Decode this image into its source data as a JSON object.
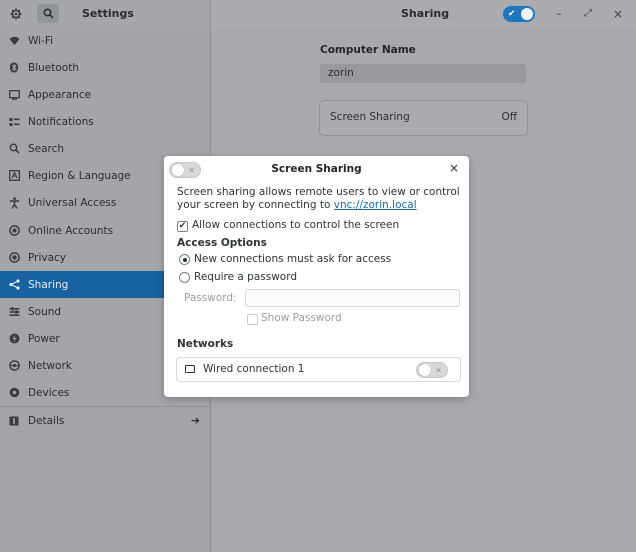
{
  "sidebar_header": {
    "title": "Settings",
    "gear_icon": "gear-icon",
    "search_icon": "search-icon"
  },
  "main_header": {
    "title": "Sharing",
    "toggle_on": true
  },
  "window_controls": {
    "minimize": "–",
    "maximize": "⤢",
    "close": "×"
  },
  "sidebar": {
    "items": [
      {
        "label": "Wi-Fi",
        "icon": "wifi-icon"
      },
      {
        "label": "Bluetooth",
        "icon": "bluetooth-icon"
      },
      {
        "label": "Appearance",
        "icon": "appearance-icon"
      },
      {
        "label": "Notifications",
        "icon": "notifications-icon"
      },
      {
        "label": "Search",
        "icon": "search-icon"
      },
      {
        "label": "Region & Language",
        "icon": "region-icon"
      },
      {
        "label": "Universal Access",
        "icon": "universal-access-icon"
      },
      {
        "label": "Online Accounts",
        "icon": "online-accounts-icon"
      },
      {
        "label": "Privacy",
        "icon": "privacy-icon"
      },
      {
        "label": "Sharing",
        "icon": "sharing-icon",
        "selected": true
      },
      {
        "label": "Sound",
        "icon": "sound-icon"
      },
      {
        "label": "Power",
        "icon": "power-icon"
      },
      {
        "label": "Network",
        "icon": "network-icon"
      },
      {
        "label": "Devices",
        "icon": "devices-icon"
      },
      {
        "label": "Details",
        "icon": "details-icon",
        "arrow": "➔"
      }
    ]
  },
  "main": {
    "computer_name_label": "Computer Name",
    "computer_name_value": "zorin",
    "screen_sharing_row": {
      "label": "Screen Sharing",
      "value": "Off"
    }
  },
  "dialog": {
    "title": "Screen Sharing",
    "toggle_on": false,
    "close": "×",
    "description": "Screen sharing allows remote users to view or control your screen by connecting to",
    "link": "vnc://zorin.local",
    "allow_control": {
      "label": "Allow connections to control the screen",
      "checked": true
    },
    "access_options_heading": "Access Options",
    "radio_ask": "New connections must ask for access",
    "radio_password": "Require a password",
    "password_label": "Password:",
    "password_value": "",
    "show_password": "Show Password",
    "networks_heading": "Networks",
    "network_name": "Wired connection 1"
  },
  "colors": {
    "accent": "#17629f",
    "link": "#1b6aa8",
    "toggle_on": "#1f77bf"
  }
}
